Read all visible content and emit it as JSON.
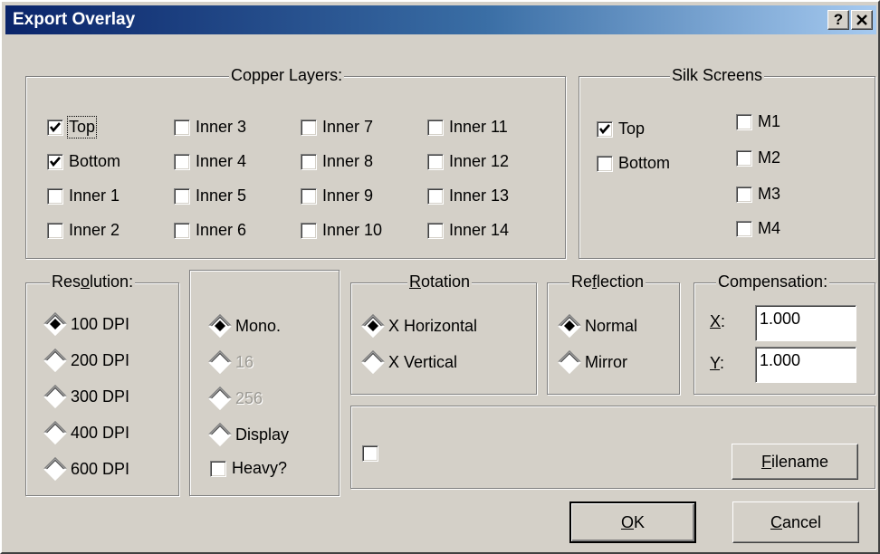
{
  "window": {
    "title": "Export Overlay",
    "help_label": "?",
    "close_label": "×"
  },
  "copper": {
    "legend": "Copper Layers:",
    "layers": [
      {
        "label": "Top",
        "checked": true
      },
      {
        "label": "Bottom",
        "checked": true
      },
      {
        "label": "Inner 1",
        "checked": false
      },
      {
        "label": "Inner 2",
        "checked": false
      },
      {
        "label": "Inner 3",
        "checked": false
      },
      {
        "label": "Inner 4",
        "checked": false
      },
      {
        "label": "Inner 5",
        "checked": false
      },
      {
        "label": "Inner 6",
        "checked": false
      },
      {
        "label": "Inner 7",
        "checked": false
      },
      {
        "label": "Inner 8",
        "checked": false
      },
      {
        "label": "Inner 9",
        "checked": false
      },
      {
        "label": "Inner 10",
        "checked": false
      },
      {
        "label": "Inner 11",
        "checked": false
      },
      {
        "label": "Inner 12",
        "checked": false
      },
      {
        "label": "Inner 13",
        "checked": false
      },
      {
        "label": "Inner 14",
        "checked": false
      }
    ]
  },
  "silk": {
    "legend": "Silk Screens",
    "layers": [
      {
        "label": "Top",
        "checked": true
      },
      {
        "label": "Bottom",
        "checked": false
      },
      {
        "label": "M1",
        "checked": false
      },
      {
        "label": "M2",
        "checked": false
      },
      {
        "label": "M3",
        "checked": false
      },
      {
        "label": "M4",
        "checked": false
      }
    ]
  },
  "resolution": {
    "legend": "Resolution:",
    "options": [
      {
        "label": "100 DPI",
        "selected": true
      },
      {
        "label": "200 DPI",
        "selected": false
      },
      {
        "label": "300 DPI",
        "selected": false
      },
      {
        "label": "400 DPI",
        "selected": false
      },
      {
        "label": "600 DPI",
        "selected": false
      }
    ]
  },
  "color": {
    "options": [
      {
        "label": "Mono.",
        "selected": true,
        "disabled": false
      },
      {
        "label": "16",
        "selected": false,
        "disabled": true
      },
      {
        "label": "256",
        "selected": false,
        "disabled": true
      },
      {
        "label": "Display",
        "selected": false,
        "disabled": false
      }
    ],
    "heavy_label": "Heavy?",
    "heavy_checked": false
  },
  "rotation": {
    "legend": "Rotation",
    "options": [
      {
        "label": "X Horizontal",
        "selected": true
      },
      {
        "label": "X Vertical",
        "selected": false
      }
    ]
  },
  "reflection": {
    "legend": "Reflection",
    "options": [
      {
        "label": "Normal",
        "selected": true
      },
      {
        "label": "Mirror",
        "selected": false
      }
    ]
  },
  "compensation": {
    "legend": "Compensation:",
    "x_label": "X:",
    "x_value": "1.000",
    "y_label": "Y:",
    "y_value": "1.000"
  },
  "file": {
    "checkbox_checked": false,
    "filename_button": "Filename"
  },
  "buttons": {
    "ok": "OK",
    "cancel": "Cancel"
  },
  "colors": {
    "title_start": "#0a246a",
    "title_end": "#a6caf0",
    "face": "#d4d0c8"
  }
}
